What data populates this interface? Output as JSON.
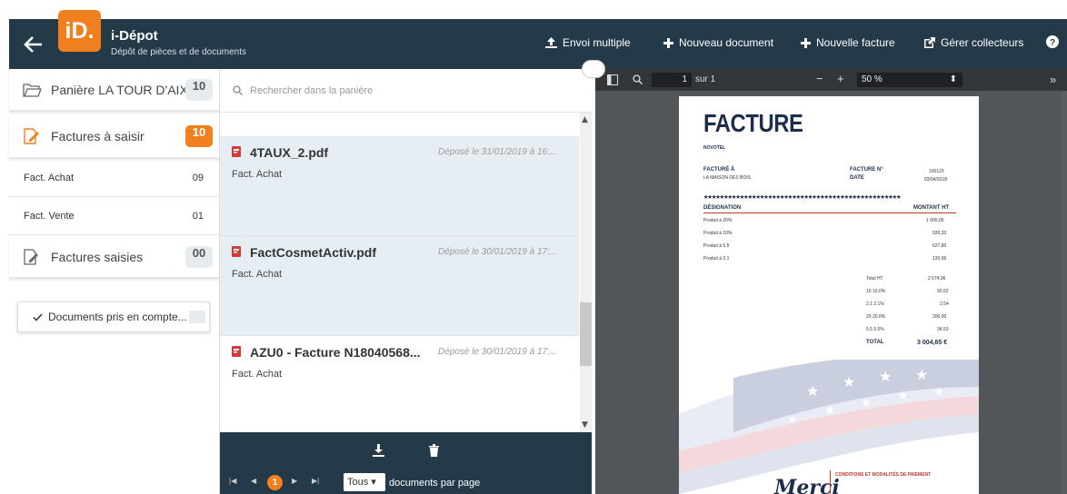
{
  "header": {
    "logo_text": "iD.",
    "title": "i-Dépot",
    "subtitle": "Dépôt de pièces et de documents",
    "actions": [
      {
        "label": "Envoi multiple",
        "icon": "upload-icon"
      },
      {
        "label": "Nouveau document",
        "icon": "plus-icon"
      },
      {
        "label": "Nouvelle facture",
        "icon": "plus-icon"
      },
      {
        "label": "Gérer collecteurs",
        "icon": "external-edit-icon"
      }
    ],
    "help_icon": "help-circle-icon",
    "accent": "#f07f1e",
    "bar_color": "#243a49"
  },
  "sidebar": {
    "folders": [
      {
        "label": "Panière LA TOUR D'AIX",
        "count": "10",
        "icon": "folder-open-icon"
      },
      {
        "label": "Factures à saisir",
        "count": "10",
        "icon": "edit-document-icon"
      },
      {
        "label": "Factures saisies",
        "count": "00",
        "icon": "saved-document-icon"
      }
    ],
    "subitems": [
      {
        "label": "Fact. Achat",
        "count": "09"
      },
      {
        "label": "Fact. Vente",
        "count": "01"
      }
    ],
    "pris_button": "Documents pris en compte..."
  },
  "documents": {
    "search_placeholder": "Rechercher dans la panière",
    "items": [
      {
        "name": "4TAUX_2.pdf",
        "date": "Déposé le 31/01/2019 à 16:...",
        "type": "Fact. Achat"
      },
      {
        "name": "FactCosmetActiv.pdf",
        "date": "Déposé le 30/01/2019 à 17:...",
        "type": "Fact. Achat"
      },
      {
        "name": "AZU0 - Facture N18040568...",
        "date": "Déposé le 30/01/2019 à 17:...",
        "type": "Fact. Achat"
      }
    ],
    "pager": {
      "current_page": "1",
      "per_page_value": "Tous",
      "per_page_label": "documents par page"
    }
  },
  "viewer": {
    "page_value": "1",
    "page_total": "sur 1",
    "zoom": "50 %",
    "invoice": {
      "title": "FACTURE",
      "company": "NOVOTEL",
      "billed_to_label": "FACTURÉ À",
      "billed_to": "LA MAISON DES BOIS",
      "number_label": "FACTURE N°",
      "number": "100123",
      "date_label": "DATE",
      "date": "03/04/2018",
      "col_designation": "DÉSIGNATION",
      "col_amount": "MONTANT HT",
      "lines": [
        {
          "label": "Produit à 20%",
          "amount": "1 000,00"
        },
        {
          "label": "Produit à 10%",
          "amount": "926,20"
        },
        {
          "label": "Produit à 5.5",
          "amount": "627,80"
        },
        {
          "label": "Produit à 2.1",
          "amount": "120,96"
        }
      ],
      "totals": [
        {
          "label": "Total HT",
          "amount": "2 674,96"
        },
        {
          "label": "10 10.0%",
          "amount": "92,62"
        },
        {
          "label": "2.1 2.1%",
          "amount": "2,54"
        },
        {
          "label": "20 20.0%",
          "amount": "200,00"
        },
        {
          "label": "5.5 5.5%",
          "amount": "34,53"
        }
      ],
      "total_label": "TOTAL",
      "total_amount": "3 004,65 €",
      "footer_script": "Merci",
      "footer_conditions": "CONDITIONS ET MODALITÉS DE PAIEMENT"
    }
  }
}
